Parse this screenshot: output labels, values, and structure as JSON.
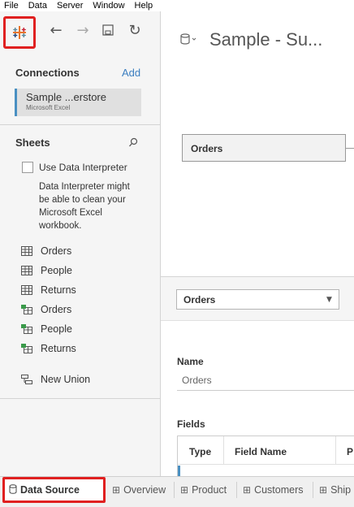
{
  "menu": [
    "File",
    "Data",
    "Server",
    "Window",
    "Help"
  ],
  "connections": {
    "header": "Connections",
    "add_label": "Add",
    "item": {
      "name": "Sample ...erstore",
      "type": "Microsoft Excel"
    }
  },
  "sheets": {
    "header": "Sheets",
    "interpreter_label": "Use Data Interpreter",
    "interpreter_desc": "Data Interpreter might be able to clean your Microsoft Excel workbook.",
    "items": [
      {
        "label": "Orders",
        "icon": "table-icon"
      },
      {
        "label": "People",
        "icon": "table-icon"
      },
      {
        "label": "Returns",
        "icon": "table-icon"
      },
      {
        "label": "Orders",
        "icon": "named-range-icon"
      },
      {
        "label": "People",
        "icon": "named-range-icon"
      },
      {
        "label": "Returns",
        "icon": "named-range-icon"
      }
    ],
    "new_union": "New Union"
  },
  "datasource": {
    "title": "Sample - Su...",
    "canvas_table": "Orders",
    "selected_table": "Orders"
  },
  "details": {
    "name_label": "Name",
    "name_value": "Orders",
    "fields_label": "Fields",
    "columns": [
      "Type",
      "Field Name",
      "P"
    ]
  },
  "bottom_tabs": [
    {
      "label": "Data Source",
      "icon": "database-icon",
      "active": true
    },
    {
      "label": "Overview",
      "icon": "worksheet-icon",
      "active": false
    },
    {
      "label": "Product",
      "icon": "worksheet-icon",
      "active": false
    },
    {
      "label": "Customers",
      "icon": "worksheet-icon",
      "active": false
    },
    {
      "label": "Ship",
      "icon": "worksheet-icon",
      "active": false
    }
  ],
  "colors": {
    "accent": "#3b7ec0",
    "highlight": "#e02020",
    "connection_bar": "#4a90c2"
  }
}
